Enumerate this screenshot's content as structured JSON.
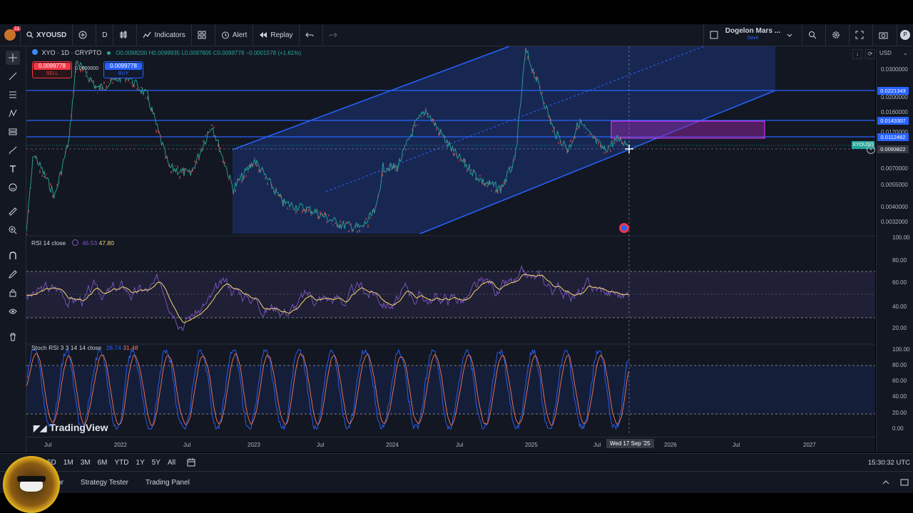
{
  "toolbar": {
    "badge": "11",
    "symbol": "XYOUSD",
    "interval": "D",
    "indicators": "Indicators",
    "alert": "Alert",
    "replay": "Replay",
    "layout_name": "Dogelon Mars ...",
    "layout_sub": "Save",
    "profile": "P"
  },
  "legend": {
    "title": "XYO · 1D · CRYPTO",
    "ohlc": "O0.0098200 H0.0099935 L0.0097805 C0.0099778 −0.0001578 (+1.61%)",
    "sell_price": "0.0099778",
    "sell_label": "SELL",
    "spread": "0.0000000",
    "buy_price": "0.0099778",
    "buy_label": "BUY"
  },
  "rsi": {
    "label": "RSI 14 close",
    "v1": "46.53",
    "v2": "47.80"
  },
  "stoch": {
    "label": "Stoch RSI 3 3 14 14 close",
    "v1": "28.74",
    "v2": "31.48"
  },
  "watermark": "TradingView",
  "axis_controls": {
    "currency": "USD"
  },
  "price_axis": [
    "0.0300000",
    "0.0200000",
    "0.0160000",
    "0.0120000",
    "0.0070000",
    "0.0055000",
    "0.0040000",
    "0.0032000"
  ],
  "price_tags": {
    "p1": "0.0221343",
    "p2": "0.0143307",
    "p3": "0.0112462",
    "p4": "0.0093822",
    "symbol_tag": "XYOUSD"
  },
  "rsi_axis": [
    "100.00",
    "80.00",
    "60.00",
    "40.00",
    "20.00"
  ],
  "stoch_axis": [
    "100.00",
    "80.00",
    "60.00",
    "40.00",
    "20.00",
    "0.00"
  ],
  "time_axis": [
    "Jul",
    "2022",
    "Jul",
    "2023",
    "Jul",
    "2024",
    "Jul",
    "2025",
    "Jul",
    "2026",
    "Jul",
    "2027"
  ],
  "crosshair_date": "Wed 17 Sep '25",
  "ranges": [
    "5D",
    "1M",
    "3M",
    "6M",
    "YTD",
    "1Y",
    "5Y",
    "All"
  ],
  "clock": "15:30:32 UTC",
  "tabs": [
    "Pine Editor",
    "Strategy Tester",
    "Trading Panel"
  ],
  "colors": {
    "bg": "#131722",
    "accent": "#2962ff",
    "rsi_line": "#7e57c2",
    "rsi_ma": "#f5d76e",
    "stoch_k": "#2962ff",
    "stoch_d": "#f7775b",
    "sell": "#f23645",
    "buy": "#2962ff"
  }
}
